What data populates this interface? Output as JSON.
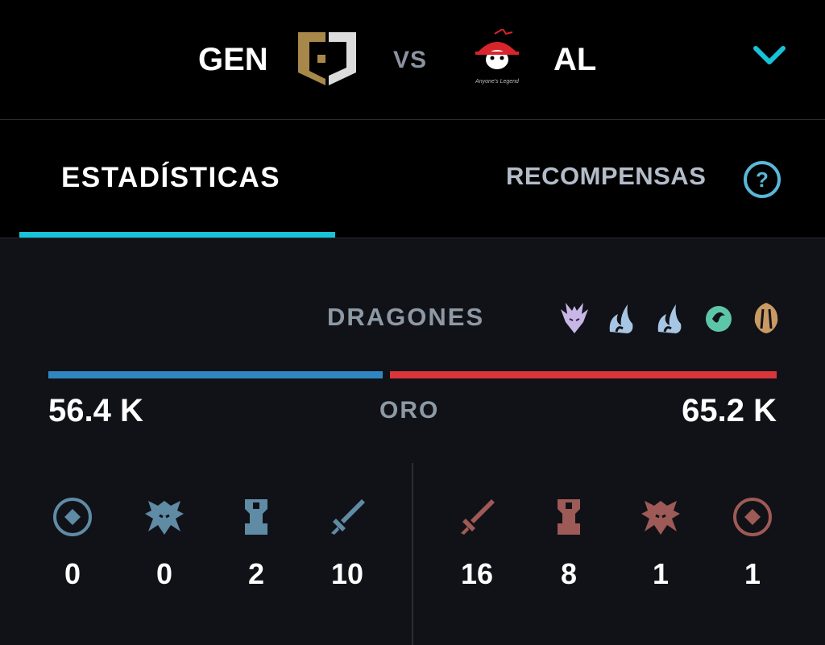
{
  "match": {
    "team_left": {
      "name": "GEN",
      "color": "#2f86c1"
    },
    "vs_label": "VS",
    "team_right": {
      "name": "AL",
      "logo_text": "Anyone's Legend",
      "color": "#d8363a"
    }
  },
  "tabs": {
    "stats_label": "ESTADÍSTICAS",
    "rewards_label": "RECOMPENSAS",
    "accent_color": "#17c3d8"
  },
  "dragons": {
    "label": "DRAGONES",
    "icons": [
      "elder-dragon-icon",
      "cloud-dragon-icon",
      "cloud-dragon-icon",
      "ocean-dragon-icon",
      "mountain-dragon-icon"
    ]
  },
  "gold": {
    "label": "ORO",
    "left": "56.4 K",
    "right": "65.2 K",
    "left_share": 0.464
  },
  "objectives": {
    "left": [
      {
        "icon": "inhibitor-icon",
        "value": "0"
      },
      {
        "icon": "baron-icon",
        "value": "0"
      },
      {
        "icon": "tower-icon",
        "value": "2"
      },
      {
        "icon": "sword-icon",
        "value": "10"
      }
    ],
    "right": [
      {
        "icon": "sword-icon",
        "value": "16"
      },
      {
        "icon": "tower-icon",
        "value": "8"
      },
      {
        "icon": "baron-icon",
        "value": "1"
      },
      {
        "icon": "inhibitor-icon",
        "value": "1"
      }
    ]
  }
}
